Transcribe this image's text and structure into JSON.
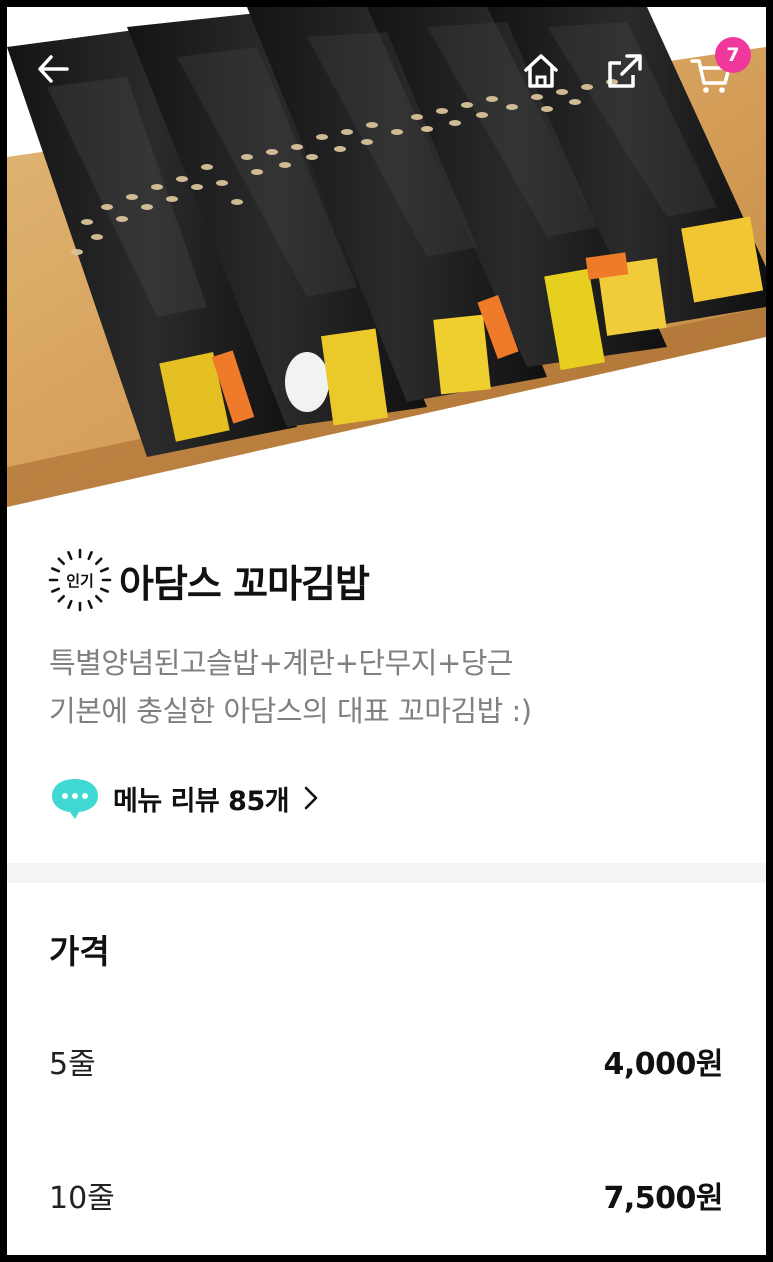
{
  "topbar": {
    "back_icon": "arrow-left-icon",
    "home_icon": "home-icon",
    "share_icon": "share-icon",
    "cart_icon": "cart-icon",
    "cart_count": "7",
    "badge_color": "#f0379b"
  },
  "product": {
    "badge_label": "인기",
    "name": "아담스 꼬마김밥",
    "description": [
      "특별양념된고슬밥+계란+단무지+당근",
      "기본에 충실한 아담스의 대표 꼬마김밥 :)"
    ],
    "review_label": "메뉴 리뷰 85개",
    "review_icon": "speech-bubble-icon",
    "review_icon_color": "#3fd8d2"
  },
  "price": {
    "title": "가격",
    "options": [
      {
        "label": "5줄",
        "value": "4,000원"
      },
      {
        "label": "10줄",
        "value": "7,500원"
      }
    ]
  }
}
